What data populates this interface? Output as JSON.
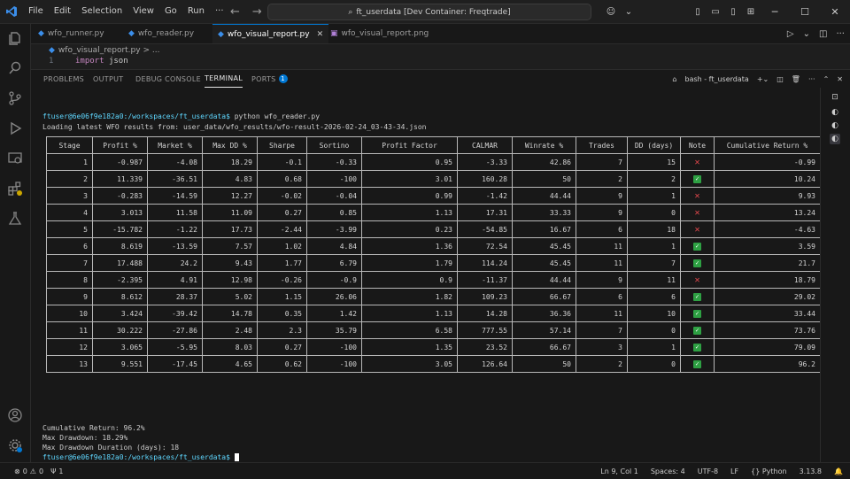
{
  "menu": [
    "File",
    "Edit",
    "Selection",
    "View",
    "Go",
    "Run"
  ],
  "command_center": "ft_userdata [Dev Container: Freqtrade]",
  "tabs": [
    {
      "label": "wfo_runner.py",
      "active": false
    },
    {
      "label": "wfo_reader.py",
      "active": false
    },
    {
      "label": "wfo_visual_report.py",
      "active": true
    },
    {
      "label": "wfo_visual_report.png",
      "active": false
    }
  ],
  "breadcrumb": "wfo_visual_report.py > ...",
  "editor": {
    "line_number": "1",
    "keyword": "import",
    "module": "json"
  },
  "panel": {
    "tabs": [
      "PROBLEMS",
      "OUTPUT",
      "DEBUG CONSOLE",
      "TERMINAL",
      "PORTS"
    ],
    "ports_badge": "1",
    "terminal_name": "bash - ft_userdata"
  },
  "terminal": {
    "prompt1": "ftuser@6e06f9e182a0:/workspaces/ft_userdata$",
    "command": " python wfo_reader.py",
    "loading": "Loading latest WFO results from: user_data/wfo_results/wfo-result-2026-02-24_03-43-34.json",
    "summary": [
      "Cumulative Return: 96.2%",
      "Max Drawdown: 18.29%",
      "Max Drawdown Duration (days): 18"
    ],
    "prompt2": "ftuser@6e06f9e182a0:/workspaces/ft_userdata$"
  },
  "table": {
    "headers": [
      "Stage",
      "Profit %",
      "Market %",
      "Max DD %",
      "Sharpe",
      "Sortino",
      "Profit Factor",
      "CALMAR",
      "Winrate %",
      "Trades",
      "DD (days)",
      "Note",
      "Cumulative Return %"
    ],
    "rows": [
      [
        "1",
        "-0.987",
        "-4.08",
        "18.29",
        "-0.1",
        "-0.33",
        "0.95",
        "-3.33",
        "42.86",
        "7",
        "15",
        "bad",
        "-0.99"
      ],
      [
        "2",
        "11.339",
        "-36.51",
        "4.83",
        "0.68",
        "-100",
        "3.01",
        "160.28",
        "50",
        "2",
        "2",
        "good",
        "10.24"
      ],
      [
        "3",
        "-0.283",
        "-14.59",
        "12.27",
        "-0.02",
        "-0.04",
        "0.99",
        "-1.42",
        "44.44",
        "9",
        "1",
        "bad",
        "9.93"
      ],
      [
        "4",
        "3.013",
        "11.58",
        "11.09",
        "0.27",
        "0.85",
        "1.13",
        "17.31",
        "33.33",
        "9",
        "0",
        "bad",
        "13.24"
      ],
      [
        "5",
        "-15.782",
        "-1.22",
        "17.73",
        "-2.44",
        "-3.99",
        "0.23",
        "-54.85",
        "16.67",
        "6",
        "18",
        "bad",
        "-4.63"
      ],
      [
        "6",
        "8.619",
        "-13.59",
        "7.57",
        "1.02",
        "4.84",
        "1.36",
        "72.54",
        "45.45",
        "11",
        "1",
        "good",
        "3.59"
      ],
      [
        "7",
        "17.488",
        "24.2",
        "9.43",
        "1.77",
        "6.79",
        "1.79",
        "114.24",
        "45.45",
        "11",
        "7",
        "good",
        "21.7"
      ],
      [
        "8",
        "-2.395",
        "4.91",
        "12.98",
        "-0.26",
        "-0.9",
        "0.9",
        "-11.37",
        "44.44",
        "9",
        "11",
        "bad",
        "18.79"
      ],
      [
        "9",
        "8.612",
        "28.37",
        "5.02",
        "1.15",
        "26.06",
        "1.82",
        "109.23",
        "66.67",
        "6",
        "6",
        "good",
        "29.02"
      ],
      [
        "10",
        "3.424",
        "-39.42",
        "14.78",
        "0.35",
        "1.42",
        "1.13",
        "14.28",
        "36.36",
        "11",
        "10",
        "good",
        "33.44"
      ],
      [
        "11",
        "30.222",
        "-27.86",
        "2.48",
        "2.3",
        "35.79",
        "6.58",
        "777.55",
        "57.14",
        "7",
        "0",
        "good",
        "73.76"
      ],
      [
        "12",
        "3.065",
        "-5.95",
        "8.03",
        "0.27",
        "-100",
        "1.35",
        "23.52",
        "66.67",
        "3",
        "1",
        "good",
        "79.09"
      ],
      [
        "13",
        "9.551",
        "-17.45",
        "4.65",
        "0.62",
        "-100",
        "3.05",
        "126.64",
        "50",
        "2",
        "0",
        "good",
        "96.2"
      ]
    ]
  },
  "status": {
    "errors": "0",
    "warnings": "0",
    "ports": "1",
    "ln_col": "Ln 9, Col 1",
    "spaces": "Spaces: 4",
    "encoding": "UTF-8",
    "eol": "LF",
    "language": "Python",
    "version": "3.13.8"
  },
  "colors": {
    "accent": "#0078d4",
    "prompt": "#5fd7ff",
    "bad": "#e5484d",
    "good": "#2ea043"
  }
}
